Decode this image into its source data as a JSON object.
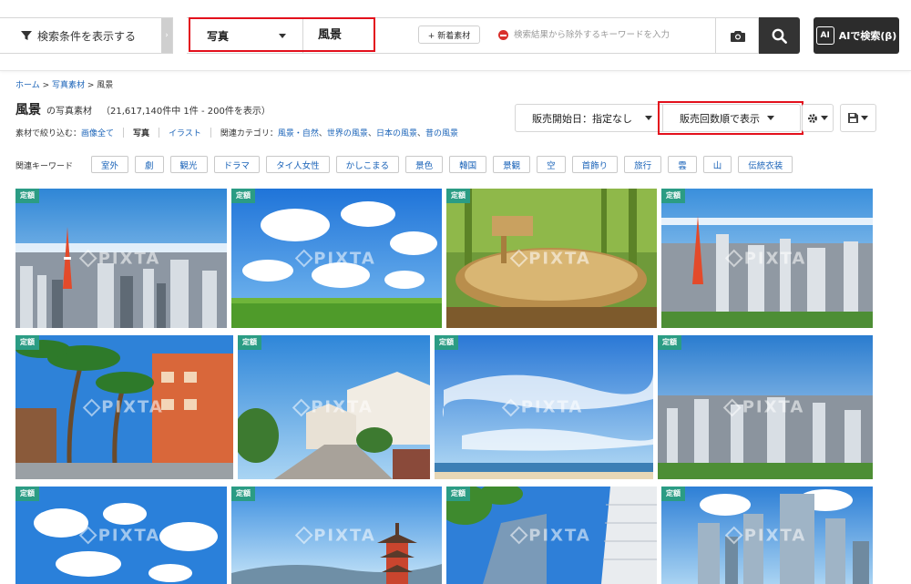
{
  "search": {
    "filter_label": "検索条件を表示する",
    "category_value": "写真",
    "keyword_value": "風景",
    "new_label": "+ 新着素材",
    "exclude_placeholder": "検索結果から除外するキーワードを入力",
    "ai_label": "AIで検索(β)",
    "ai_badge": "AI"
  },
  "breadcrumb": {
    "home": "ホーム",
    "sep1": " > ",
    "photos": "写真素材",
    "sep2": " > ",
    "current": "風景"
  },
  "results": {
    "keyword": "風景",
    "suffix": "の写真素材",
    "count": "（21,617,140件中 1件 - 200件を表示）"
  },
  "narrow": {
    "label": "素材で絞り込む：",
    "all": "画像全て",
    "photo": "写真",
    "illust": "イラスト",
    "related_label": "関連カテゴリ：",
    "related": [
      "風景・自然",
      "世界の風景",
      "日本の風景",
      "昔の風景"
    ],
    "comma": "、"
  },
  "sort": {
    "date_label": "販売開始日：指定なし",
    "count_label": "販売回数順で表示"
  },
  "keywords": {
    "label": "関連キーワード",
    "tags": [
      "室外",
      "劇",
      "観光",
      "ドラマ",
      "タイ人女性",
      "かしこまる",
      "景色",
      "韓国",
      "景観",
      "空",
      "首飾り",
      "旅行",
      "雲",
      "山",
      "伝統衣装"
    ]
  },
  "grid": {
    "badge": "定額",
    "watermark": "PIXTA",
    "photos": [
      "tokyo-tower-skyline",
      "green-field-blue-sky",
      "bamboo-water-basin",
      "tokyo-tower-city",
      "palm-tree-street",
      "residential-street",
      "sky-over-sea",
      "city-aerial",
      "clouds-blue-sky",
      "kiyomizu-pagoda",
      "office-building-trees",
      "skyscrapers"
    ]
  },
  "colors": {
    "accent_red": "#e3101c",
    "badge_green": "#2b9c84",
    "link_blue": "#1a63b8"
  }
}
